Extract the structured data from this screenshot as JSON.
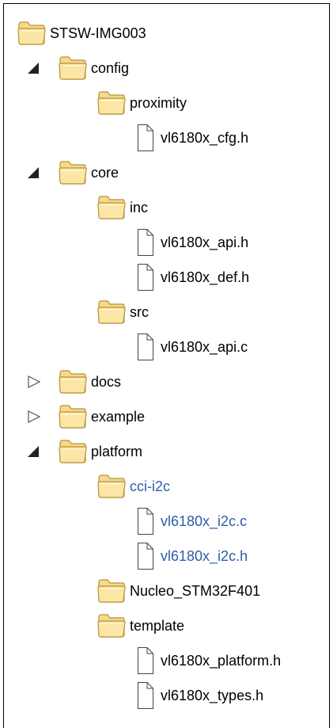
{
  "tree": {
    "nodes": [
      {
        "label": "STSW-IMG003",
        "kind": "folder",
        "depth": 0,
        "arrow": "none",
        "highlight": false
      },
      {
        "label": "config",
        "kind": "folder",
        "depth": 1,
        "arrow": "expanded",
        "highlight": false
      },
      {
        "label": "proximity",
        "kind": "folder",
        "depth": 2,
        "arrow": "none",
        "highlight": false
      },
      {
        "label": "vl6180x_cfg.h",
        "kind": "file",
        "depth": 3,
        "arrow": "none",
        "highlight": false
      },
      {
        "label": "core",
        "kind": "folder",
        "depth": 1,
        "arrow": "expanded",
        "highlight": false
      },
      {
        "label": "inc",
        "kind": "folder",
        "depth": 2,
        "arrow": "none",
        "highlight": false
      },
      {
        "label": "vl6180x_api.h",
        "kind": "file",
        "depth": 3,
        "arrow": "none",
        "highlight": false
      },
      {
        "label": "vl6180x_def.h",
        "kind": "file",
        "depth": 3,
        "arrow": "none",
        "highlight": false
      },
      {
        "label": "src",
        "kind": "folder",
        "depth": 2,
        "arrow": "none",
        "highlight": false
      },
      {
        "label": "vl6180x_api.c",
        "kind": "file",
        "depth": 3,
        "arrow": "none",
        "highlight": false
      },
      {
        "label": "docs",
        "kind": "folder",
        "depth": 1,
        "arrow": "collapsed",
        "highlight": false
      },
      {
        "label": "example",
        "kind": "folder",
        "depth": 1,
        "arrow": "collapsed",
        "highlight": false
      },
      {
        "label": "platform",
        "kind": "folder",
        "depth": 1,
        "arrow": "expanded",
        "highlight": false
      },
      {
        "label": "cci-i2c",
        "kind": "folder",
        "depth": 2,
        "arrow": "none",
        "highlight": true
      },
      {
        "label": "vl6180x_i2c.c",
        "kind": "file",
        "depth": 3,
        "arrow": "none",
        "highlight": true
      },
      {
        "label": "vl6180x_i2c.h",
        "kind": "file",
        "depth": 3,
        "arrow": "none",
        "highlight": true
      },
      {
        "label": "Nucleo_STM32F401",
        "kind": "folder",
        "depth": 2,
        "arrow": "none",
        "highlight": false
      },
      {
        "label": "template",
        "kind": "folder",
        "depth": 2,
        "arrow": "none",
        "highlight": false
      },
      {
        "label": "vl6180x_platform.h",
        "kind": "file",
        "depth": 3,
        "arrow": "none",
        "highlight": false
      },
      {
        "label": "vl6180x_types.h",
        "kind": "file",
        "depth": 3,
        "arrow": "none",
        "highlight": false
      }
    ]
  },
  "colors": {
    "highlight_text": "#2e5da8",
    "folder_fill": "#f6d98a",
    "folder_stroke": "#b8923a"
  },
  "icons": {
    "folder": "folder-icon",
    "file": "file-icon",
    "expanded": "expanded-arrow-icon",
    "collapsed": "collapsed-arrow-icon"
  }
}
